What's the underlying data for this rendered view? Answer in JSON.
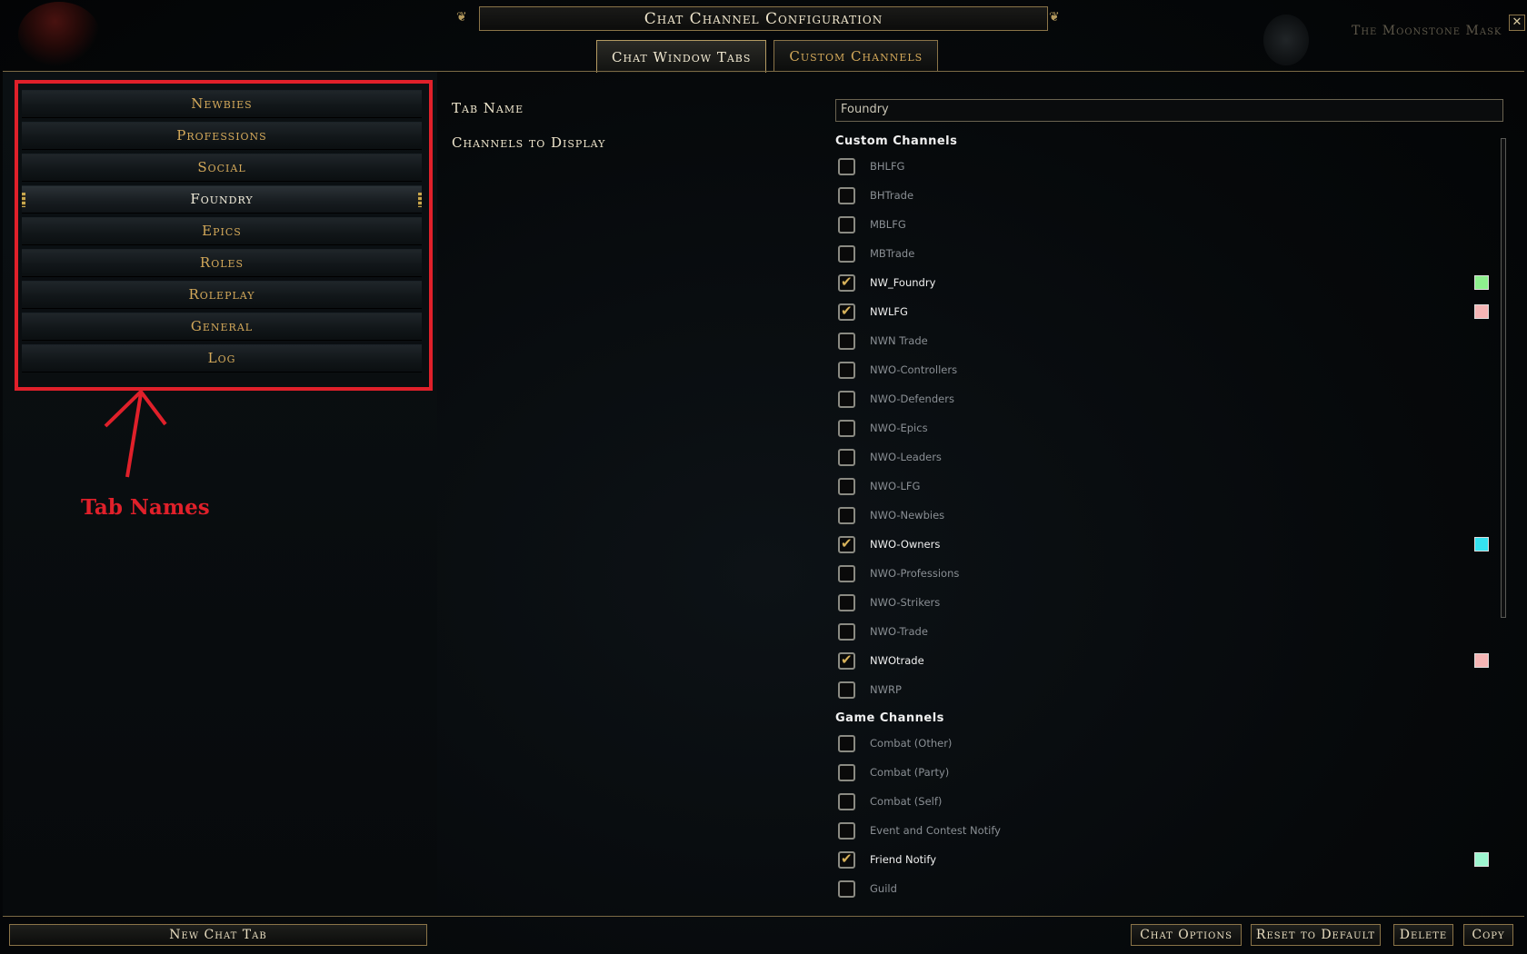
{
  "window": {
    "title": "Chat Channel Configuration",
    "close_glyph": "✕",
    "location": "The Moonstone Mask"
  },
  "top_tabs": [
    {
      "label": "Chat Window Tabs",
      "active": true
    },
    {
      "label": "Custom Channels",
      "active": false
    }
  ],
  "tab_list": [
    {
      "label": "Newbies",
      "selected": false
    },
    {
      "label": "Professions",
      "selected": false
    },
    {
      "label": "Social",
      "selected": false
    },
    {
      "label": "Foundry",
      "selected": true
    },
    {
      "label": "Epics",
      "selected": false
    },
    {
      "label": "Roles",
      "selected": false
    },
    {
      "label": "Roleplay",
      "selected": false
    },
    {
      "label": "General",
      "selected": false
    },
    {
      "label": "Log",
      "selected": false
    }
  ],
  "annotation": {
    "label": "Tab Names",
    "color": "#e0202a"
  },
  "form": {
    "tab_name_label": "Tab Name",
    "tab_name_value": "Foundry",
    "channels_label": "Channels to Display"
  },
  "custom_channels": {
    "heading": "Custom Channels",
    "items": [
      {
        "name": "BHLFG",
        "checked": false
      },
      {
        "name": "BHTrade",
        "checked": false
      },
      {
        "name": "MBLFG",
        "checked": false
      },
      {
        "name": "MBTrade",
        "checked": false
      },
      {
        "name": "NW_Foundry",
        "checked": true,
        "color": "#8ef08e"
      },
      {
        "name": "NWLFG",
        "checked": true,
        "color": "#f5b5b5"
      },
      {
        "name": "NWN Trade",
        "checked": false
      },
      {
        "name": "NWO-Controllers",
        "checked": false
      },
      {
        "name": "NWO-Defenders",
        "checked": false
      },
      {
        "name": "NWO-Epics",
        "checked": false
      },
      {
        "name": "NWO-Leaders",
        "checked": false
      },
      {
        "name": "NWO-LFG",
        "checked": false
      },
      {
        "name": "NWO-Newbies",
        "checked": false
      },
      {
        "name": "NWO-Owners",
        "checked": true,
        "color": "#35e2f0"
      },
      {
        "name": "NWO-Professions",
        "checked": false
      },
      {
        "name": "NWO-Strikers",
        "checked": false
      },
      {
        "name": "NWO-Trade",
        "checked": false
      },
      {
        "name": "NWOtrade",
        "checked": true,
        "color": "#f5b5b5"
      },
      {
        "name": "NWRP",
        "checked": false
      }
    ]
  },
  "game_channels": {
    "heading": "Game Channels",
    "items": [
      {
        "name": "Combat (Other)",
        "checked": false
      },
      {
        "name": "Combat (Party)",
        "checked": false
      },
      {
        "name": "Combat (Self)",
        "checked": false
      },
      {
        "name": "Event and Contest Notify",
        "checked": false
      },
      {
        "name": "Friend Notify",
        "checked": true,
        "color": "#9ef5d0"
      },
      {
        "name": "Guild",
        "checked": false
      }
    ]
  },
  "buttons": {
    "new_chat_tab": "New Chat Tab",
    "chat_options": "Chat Options",
    "reset_default": "Reset to Default",
    "delete": "Delete",
    "copy": "Copy"
  }
}
